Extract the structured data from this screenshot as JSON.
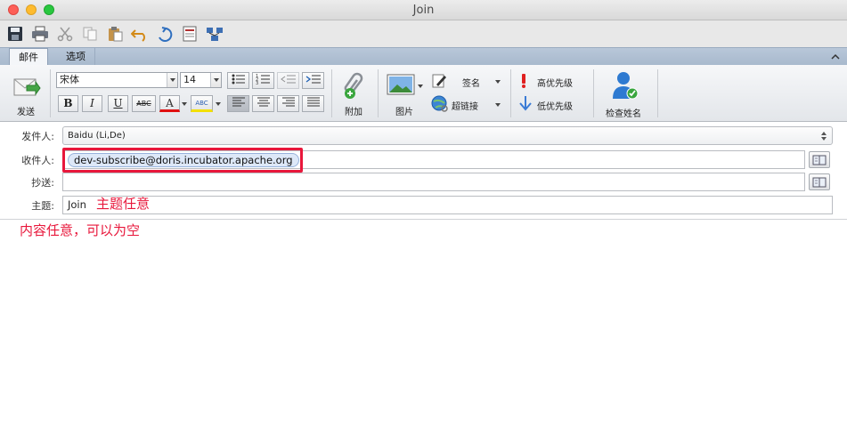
{
  "window": {
    "title": "Join"
  },
  "quick_toolbar": {
    "icons": [
      "save-icon",
      "print-icon",
      "cut-icon",
      "copy-icon",
      "paste-icon",
      "undo-icon",
      "redo-icon",
      "form-icon",
      "network-icon"
    ]
  },
  "ribbon": {
    "tabs": [
      {
        "label": "邮件",
        "active": true
      },
      {
        "label": "选项",
        "active": false
      }
    ],
    "send_label": "发送",
    "font": {
      "family": "宋体",
      "size": "14"
    },
    "format_buttons": {
      "bold": "B",
      "italic": "I",
      "underline": "U",
      "strike": "ABC",
      "font_color": "A",
      "highlight": "ABC"
    },
    "attach_label": "附加",
    "picture_label": "图片",
    "signature_label": "签名",
    "hyperlink_label": "超链接",
    "high_priority_label": "高优先级",
    "low_priority_label": "低优先级",
    "check_names_label": "检查姓名"
  },
  "compose": {
    "from": {
      "label": "发件人:",
      "value": "Baidu (Li,De)"
    },
    "to": {
      "label": "收件人:",
      "recipient": "dev-subscribe@doris.incubator.apache.org"
    },
    "cc": {
      "label": "抄送:",
      "value": ""
    },
    "subject": {
      "label": "主题:",
      "value": "Join"
    }
  },
  "annotations": {
    "subject_note": "主题任意",
    "body_note": "内容任意，可以为空"
  },
  "colors": {
    "annotation_red": "#e8173b",
    "chip_bg": "#dde8f8"
  }
}
